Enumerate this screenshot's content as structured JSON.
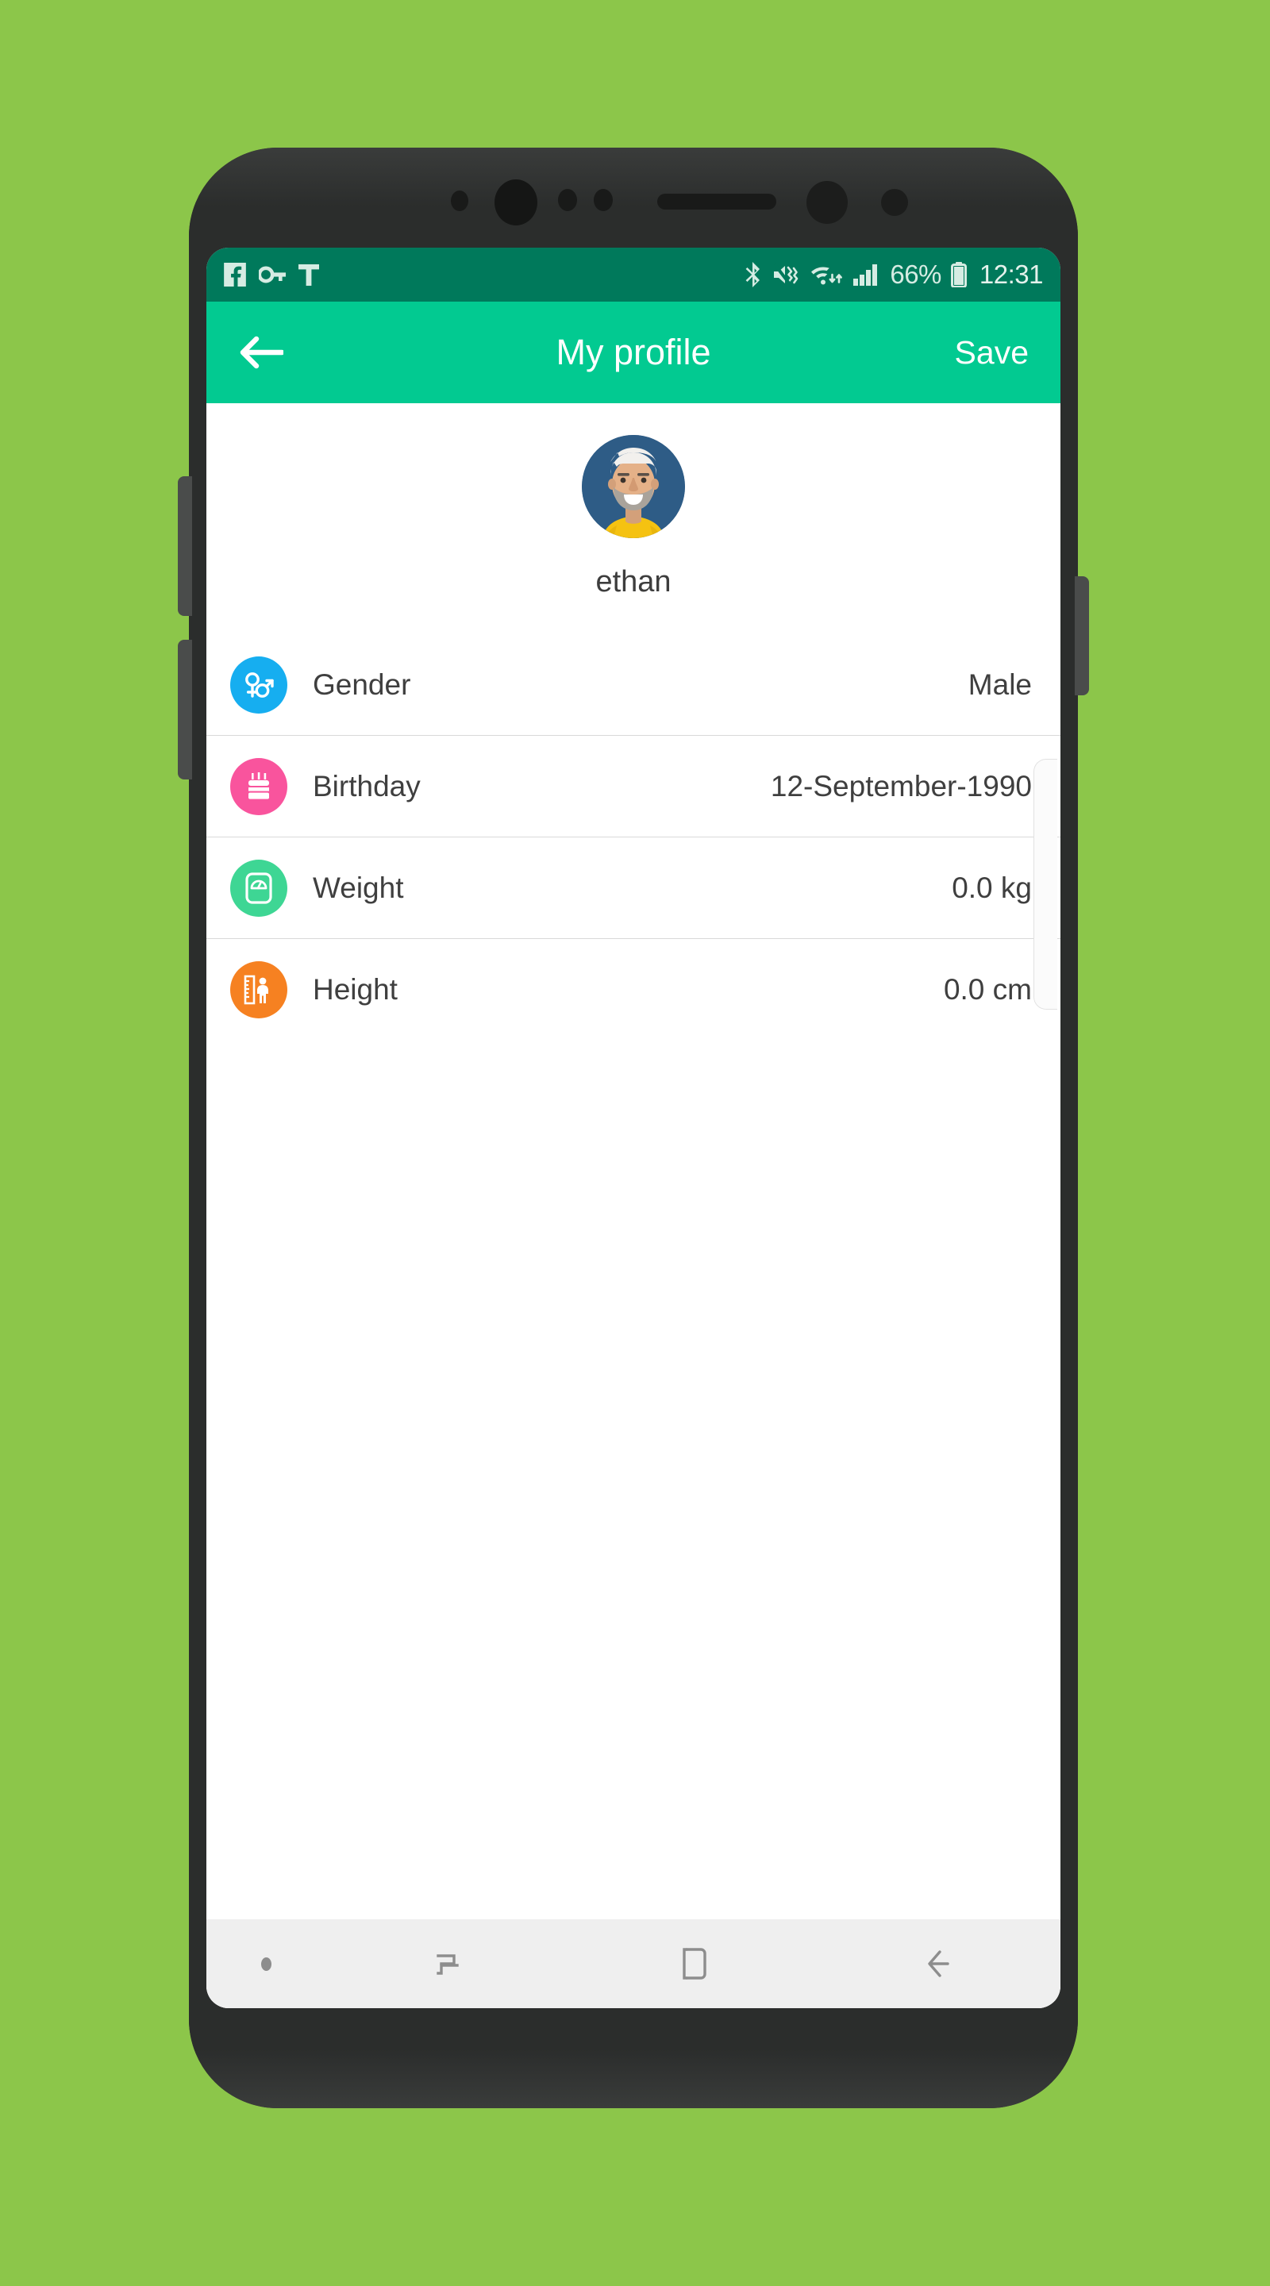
{
  "background_color": "#8cc64a",
  "theme": {
    "app_bar_color": "#02ca91",
    "status_bar_color": "#00795b",
    "frame_color": "#2b2d2c",
    "nav_bar_color": "#efefef"
  },
  "status_bar": {
    "left_icons": [
      "facebook-icon",
      "vpn-key-icon",
      "text-t-icon"
    ],
    "right_icons": [
      "bluetooth-icon",
      "mute-vibrate-icon",
      "wifi-transfer-icon",
      "signal-bars-icon",
      "battery-icon"
    ],
    "battery_percent": "66%",
    "clock": "12:31"
  },
  "app_bar": {
    "back_icon": "arrow-left-icon",
    "title": "My profile",
    "save_label": "Save"
  },
  "profile": {
    "avatar_icon": "user-avatar-image",
    "name": "ethan"
  },
  "info_list": [
    {
      "label": "Gender",
      "value": "Male",
      "icon": "gender-icon",
      "icon_color": "#16AEF0"
    },
    {
      "label": "Birthday",
      "value": "12-September-1990",
      "icon": "birthday-cake-icon",
      "icon_color": "#F9549D"
    },
    {
      "label": "Weight",
      "value": "0.0 kg",
      "icon": "weight-scale-icon",
      "icon_color": "#3ED694"
    },
    {
      "label": "Height",
      "value": "0.0 cm",
      "icon": "height-ruler-icon",
      "icon_color": "#F68121"
    }
  ],
  "nav_bar": {
    "items": [
      "menu-dot-indicator",
      "recents-icon",
      "home-icon",
      "back-icon"
    ]
  }
}
